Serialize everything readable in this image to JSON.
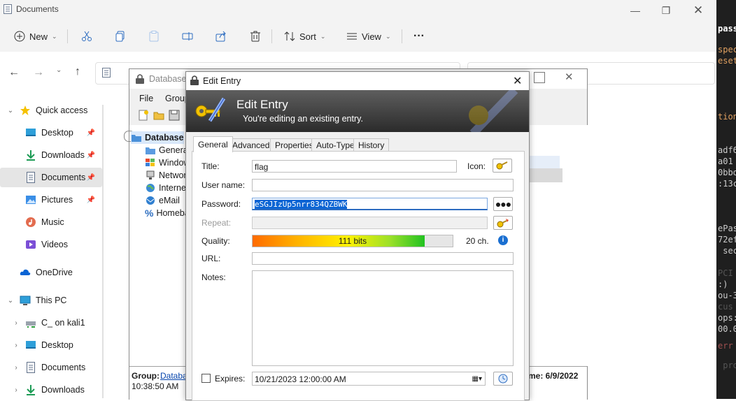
{
  "explorer": {
    "title": "Documents",
    "toolbar": {
      "new": "New",
      "sort": "Sort",
      "view": "View",
      "more": "···"
    },
    "nav": {
      "quick_access": "Quick access",
      "items": [
        {
          "label": "Desktop"
        },
        {
          "label": "Downloads"
        },
        {
          "label": "Documents"
        },
        {
          "label": "Pictures"
        },
        {
          "label": "Music"
        },
        {
          "label": "Videos"
        }
      ],
      "onedrive": "OneDrive",
      "this_pc": "This PC",
      "pc_items": [
        {
          "label": "C_ on kali1"
        },
        {
          "label": "Desktop"
        },
        {
          "label": "Documents"
        },
        {
          "label": "Downloads"
        }
      ]
    }
  },
  "terminal": {
    "lines": [
      {
        "text": "pass",
        "color": "#ffffff"
      },
      {
        "text": "spec",
        "color": "#e0a060"
      },
      {
        "text": "eset",
        "color": "#e0a060"
      },
      {
        "text": "tion",
        "color": "#e0a060"
      },
      {
        "text": "adf6",
        "color": "#cccccc"
      },
      {
        "text": "a01",
        "color": "#cccccc"
      },
      {
        "text": "0bbo",
        "color": "#cccccc"
      },
      {
        "text": ":13c",
        "color": "#cccccc"
      },
      {
        "text": "ePas",
        "color": "#cccccc"
      },
      {
        "text": "72ef",
        "color": "#cccccc"
      },
      {
        "text": " sec",
        "color": "#cccccc"
      },
      {
        "text": "PCI",
        "color": "#555555"
      },
      {
        "text": ":)",
        "color": "#cccccc"
      },
      {
        "text": "ou-3",
        "color": "#cccccc"
      },
      {
        "text": "cus",
        "color": "#555555"
      },
      {
        "text": "ops:",
        "color": "#cccccc"
      },
      {
        "text": "00.0",
        "color": "#cccccc"
      },
      {
        "text": "err",
        "color": "#a05050"
      },
      {
        "text": " pro",
        "color": "#555555"
      }
    ]
  },
  "keepass": {
    "title": "Database.",
    "menu": {
      "file": "File",
      "group": "Group"
    },
    "tree": {
      "root": "Database",
      "items": [
        {
          "label": "General"
        },
        {
          "label": "Windows"
        },
        {
          "label": "Network"
        },
        {
          "label": "Internet"
        },
        {
          "label": "eMail"
        },
        {
          "label": "Homebanking"
        }
      ]
    },
    "status": {
      "group_label": "Group:",
      "group_value": "Database",
      "time": "10:38:50 AM",
      "modified": "me: 6/9/2022"
    }
  },
  "dialog": {
    "window_title": "Edit Entry",
    "banner_title": "Edit Entry",
    "banner_subtitle": "You're editing an existing entry.",
    "tabs": [
      "General",
      "Advanced",
      "Properties",
      "Auto-Type",
      "History"
    ],
    "labels": {
      "title": "Title:",
      "icon": "Icon:",
      "username": "User name:",
      "password": "Password:",
      "repeat": "Repeat:",
      "quality": "Quality:",
      "url": "URL:",
      "notes": "Notes:",
      "expires": "Expires:"
    },
    "values": {
      "title": "flag",
      "username": "",
      "password": "eSGJIzUp5nrr834QZBWK",
      "repeat": "",
      "url": "",
      "notes": "",
      "expires": "10/21/2023 12:00:00 AM"
    },
    "quality": {
      "text": "111 bits",
      "fraction": 0.86,
      "chars": "20 ch."
    }
  }
}
